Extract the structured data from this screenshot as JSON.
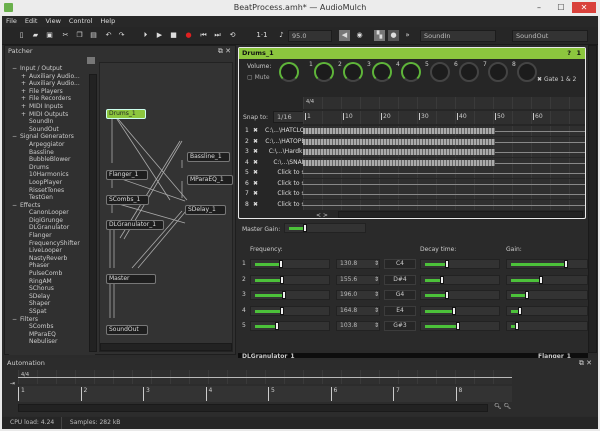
{
  "window": {
    "title": "BeatProcess.amh* — AudioMulch",
    "minimize": "–",
    "maximize": "☐",
    "close": "✕"
  },
  "menu": [
    "File",
    "Edit",
    "View",
    "Control",
    "Help"
  ],
  "toolbar": {
    "bar_beat": "1·1",
    "tempo": "95.0",
    "sound_in": "SoundIn",
    "sound_out": "SoundOut",
    "more": "»"
  },
  "patcher": {
    "title": "Patcher",
    "tree": [
      {
        "label": "Input / Output",
        "level": 0,
        "marker": "−"
      },
      {
        "label": "Auxiliary Audio...",
        "level": 1,
        "marker": "+"
      },
      {
        "label": "Auxiliary Audio...",
        "level": 1,
        "marker": "+"
      },
      {
        "label": "File Players",
        "level": 1,
        "marker": "+"
      },
      {
        "label": "File Recorders",
        "level": 1,
        "marker": "+"
      },
      {
        "label": "MIDI Inputs",
        "level": 1,
        "marker": "+"
      },
      {
        "label": "MIDI Outputs",
        "level": 1,
        "marker": "+"
      },
      {
        "label": "SoundIn",
        "level": 1,
        "marker": ""
      },
      {
        "label": "SoundOut",
        "level": 1,
        "marker": ""
      },
      {
        "label": "Signal Generators",
        "level": 0,
        "marker": "−"
      },
      {
        "label": "Arpeggiator",
        "level": 1,
        "marker": ""
      },
      {
        "label": "Bassline",
        "level": 1,
        "marker": ""
      },
      {
        "label": "BubbleBlower",
        "level": 1,
        "marker": ""
      },
      {
        "label": "Drums",
        "level": 1,
        "marker": ""
      },
      {
        "label": "10Harmonics",
        "level": 1,
        "marker": ""
      },
      {
        "label": "LoopPlayer",
        "level": 1,
        "marker": ""
      },
      {
        "label": "RissetTones",
        "level": 1,
        "marker": ""
      },
      {
        "label": "TestGen",
        "level": 1,
        "marker": ""
      },
      {
        "label": "Effects",
        "level": 0,
        "marker": "−"
      },
      {
        "label": "CanonLooper",
        "level": 1,
        "marker": ""
      },
      {
        "label": "DigiGrunge",
        "level": 1,
        "marker": ""
      },
      {
        "label": "DLGranulator",
        "level": 1,
        "marker": ""
      },
      {
        "label": "Flanger",
        "level": 1,
        "marker": ""
      },
      {
        "label": "FrequencyShifter",
        "level": 1,
        "marker": ""
      },
      {
        "label": "LiveLooper",
        "level": 1,
        "marker": ""
      },
      {
        "label": "NastyReverb",
        "level": 1,
        "marker": ""
      },
      {
        "label": "Phaser",
        "level": 1,
        "marker": ""
      },
      {
        "label": "PulseComb",
        "level": 1,
        "marker": ""
      },
      {
        "label": "RingAM",
        "level": 1,
        "marker": ""
      },
      {
        "label": "SChorus",
        "level": 1,
        "marker": ""
      },
      {
        "label": "SDelay",
        "level": 1,
        "marker": ""
      },
      {
        "label": "Shaper",
        "level": 1,
        "marker": ""
      },
      {
        "label": "SSpat",
        "level": 1,
        "marker": ""
      },
      {
        "label": "Filters",
        "level": 0,
        "marker": "−"
      },
      {
        "label": "SCombs",
        "level": 1,
        "marker": ""
      },
      {
        "label": "MParaEQ",
        "level": 1,
        "marker": ""
      },
      {
        "label": "Nebuliser",
        "level": 1,
        "marker": ""
      }
    ],
    "nodes": {
      "drums": "Drums_1",
      "flanger": "Flanger_1",
      "scombs": "SCombs_1",
      "dlgran": "DLGranulator_1",
      "master": "Master",
      "soundout": "SoundOut",
      "bassline": "Bassline_1",
      "mparaeq": "MParaEQ_1",
      "sdelay": "SDelay_1"
    }
  },
  "drums": {
    "title": "Drums_1",
    "help": "?",
    "index": "1",
    "volume_label": "Volume:",
    "mute_label": "Mute",
    "knob_labels": [
      "1",
      "2",
      "3",
      "4",
      "5",
      "6",
      "7",
      "8"
    ],
    "gate_label": "Gate 1 & 2",
    "time_sig": "4/4",
    "snap_label": "Snap to:",
    "snap_value": "1/16",
    "ruler": [
      "1",
      "10",
      "20",
      "30",
      "40",
      "50",
      "60"
    ],
    "tracks": [
      {
        "n": "1",
        "file": "C:\\...\\HATCLOSD.WAV"
      },
      {
        "n": "2",
        "file": "C:\\...\\HATOPEN.WAV"
      },
      {
        "n": "3",
        "file": "C:\\...\\Hardkick.wav"
      },
      {
        "n": "4",
        "file": "C:\\...\\SNARE.WAV"
      },
      {
        "n": "5",
        "file": "Click to select..."
      },
      {
        "n": "6",
        "file": "Click to select..."
      },
      {
        "n": "7",
        "file": "Click to select..."
      },
      {
        "n": "8",
        "file": "Click to select..."
      }
    ],
    "nav": "< >"
  },
  "params": {
    "master_gain_label": "Master Gain:",
    "master_gain": 0.2,
    "frequency_label": "Frequency:",
    "decay_label": "Decay time:",
    "gain_label": "Gain:",
    "rows": [
      {
        "n": "1",
        "freq": "130.8",
        "note": "C4",
        "f": 0.35,
        "d": 0.3,
        "g": 0.75
      },
      {
        "n": "2",
        "freq": "155.6",
        "note": "D#4",
        "f": 0.37,
        "d": 0.22,
        "g": 0.4
      },
      {
        "n": "3",
        "freq": "196.0",
        "note": "G4",
        "f": 0.4,
        "d": 0.3,
        "g": 0.2
      },
      {
        "n": "4",
        "freq": "164.8",
        "note": "E4",
        "f": 0.37,
        "d": 0.4,
        "g": 0.1
      },
      {
        "n": "5",
        "freq": "103.8",
        "note": "G#3",
        "f": 0.3,
        "d": 0.45,
        "g": 0.05
      }
    ],
    "next_panels": [
      "DLGranulator_1",
      "Flanger_1"
    ]
  },
  "automation": {
    "title": "Automation",
    "time_sig": "4/4",
    "bars": [
      "1",
      "2",
      "3",
      "4",
      "5",
      "6",
      "7",
      "8"
    ]
  },
  "status": {
    "cpu": "CPU load: 4.24",
    "samples": "Samples: 282 kB"
  }
}
